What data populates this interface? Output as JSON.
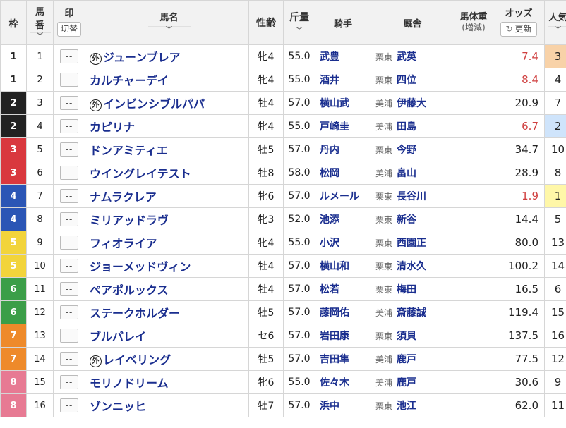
{
  "header": {
    "waku": "枠",
    "umaban_top": "馬",
    "umaban_bottom": "番",
    "mark": "印",
    "mark_toggle": "切替",
    "name": "馬名",
    "sexage": "性齢",
    "weight": "斤量",
    "jockey": "騎手",
    "stable": "厩舎",
    "body_weight": "馬体重",
    "body_weight_sub": "(増減)",
    "odds": "オッズ",
    "odds_refresh": "更新",
    "popularity": "人気",
    "sort_chevron": "﹀"
  },
  "mark_placeholder": "--",
  "foreign_badge": "外",
  "colors": {
    "waku1": "#ffffff",
    "waku2": "#222222",
    "waku3": "#d9383e",
    "waku4": "#2a55b5",
    "waku5": "#f2d43b",
    "waku6": "#3b9e48",
    "waku7": "#ee8a2a",
    "waku8": "#e77a93",
    "link": "#1a2e8f",
    "odds_favored": "#d04040",
    "pop1": "#fff7a8",
    "pop2": "#cfe4fb",
    "pop3": "#f8d2a8"
  },
  "rows": [
    {
      "waku": "1",
      "umaban": "1",
      "foreign": true,
      "name": "ジューンブレア",
      "sexage": "牝4",
      "weight": "55.0",
      "jockey": "武豊",
      "area": "栗東",
      "stable": "武英",
      "odds": "7.4",
      "pop": "3"
    },
    {
      "waku": "1",
      "umaban": "2",
      "foreign": false,
      "name": "カルチャーデイ",
      "sexage": "牝4",
      "weight": "55.0",
      "jockey": "酒井",
      "area": "栗東",
      "stable": "四位",
      "odds": "8.4",
      "pop": "4"
    },
    {
      "waku": "2",
      "umaban": "3",
      "foreign": true,
      "name": "インビンシブルパパ",
      "sexage": "牡4",
      "weight": "57.0",
      "jockey": "横山武",
      "area": "美浦",
      "stable": "伊藤大",
      "odds": "20.9",
      "pop": "7"
    },
    {
      "waku": "2",
      "umaban": "4",
      "foreign": false,
      "name": "カピリナ",
      "sexage": "牝4",
      "weight": "55.0",
      "jockey": "戸崎圭",
      "area": "美浦",
      "stable": "田島",
      "odds": "6.7",
      "pop": "2"
    },
    {
      "waku": "3",
      "umaban": "5",
      "foreign": false,
      "name": "ドンアミティエ",
      "sexage": "牡5",
      "weight": "57.0",
      "jockey": "丹内",
      "area": "栗東",
      "stable": "今野",
      "odds": "34.7",
      "pop": "10"
    },
    {
      "waku": "3",
      "umaban": "6",
      "foreign": false,
      "name": "ウイングレイテスト",
      "sexage": "牡8",
      "weight": "58.0",
      "jockey": "松岡",
      "area": "美浦",
      "stable": "畠山",
      "odds": "28.9",
      "pop": "8"
    },
    {
      "waku": "4",
      "umaban": "7",
      "foreign": false,
      "name": "ナムラクレア",
      "sexage": "牝6",
      "weight": "57.0",
      "jockey": "ルメール",
      "area": "栗東",
      "stable": "長谷川",
      "odds": "1.9",
      "pop": "1"
    },
    {
      "waku": "4",
      "umaban": "8",
      "foreign": false,
      "name": "ミリアッドラヴ",
      "sexage": "牝3",
      "weight": "52.0",
      "jockey": "池添",
      "area": "栗東",
      "stable": "新谷",
      "odds": "14.4",
      "pop": "5"
    },
    {
      "waku": "5",
      "umaban": "9",
      "foreign": false,
      "name": "フィオライア",
      "sexage": "牝4",
      "weight": "55.0",
      "jockey": "小沢",
      "area": "栗東",
      "stable": "西園正",
      "odds": "80.0",
      "pop": "13"
    },
    {
      "waku": "5",
      "umaban": "10",
      "foreign": false,
      "name": "ジョーメッドヴィン",
      "sexage": "牡4",
      "weight": "57.0",
      "jockey": "横山和",
      "area": "栗東",
      "stable": "清水久",
      "odds": "100.2",
      "pop": "14"
    },
    {
      "waku": "6",
      "umaban": "11",
      "foreign": false,
      "name": "ペアポルックス",
      "sexage": "牡4",
      "weight": "57.0",
      "jockey": "松若",
      "area": "栗東",
      "stable": "梅田",
      "odds": "16.5",
      "pop": "6"
    },
    {
      "waku": "6",
      "umaban": "12",
      "foreign": false,
      "name": "ステークホルダー",
      "sexage": "牡5",
      "weight": "57.0",
      "jockey": "藤岡佑",
      "area": "美浦",
      "stable": "斎藤誠",
      "odds": "119.4",
      "pop": "15"
    },
    {
      "waku": "7",
      "umaban": "13",
      "foreign": false,
      "name": "ブルバレイ",
      "sexage": "セ6",
      "weight": "57.0",
      "jockey": "岩田康",
      "area": "栗東",
      "stable": "須貝",
      "odds": "137.5",
      "pop": "16"
    },
    {
      "waku": "7",
      "umaban": "14",
      "foreign": true,
      "name": "レイベリング",
      "sexage": "牡5",
      "weight": "57.0",
      "jockey": "吉田隼",
      "area": "美浦",
      "stable": "鹿戸",
      "odds": "77.5",
      "pop": "12"
    },
    {
      "waku": "8",
      "umaban": "15",
      "foreign": false,
      "name": "モリノドリーム",
      "sexage": "牝6",
      "weight": "55.0",
      "jockey": "佐々木",
      "area": "美浦",
      "stable": "鹿戸",
      "odds": "30.6",
      "pop": "9"
    },
    {
      "waku": "8",
      "umaban": "16",
      "foreign": false,
      "name": "ゾンニッヒ",
      "sexage": "牡7",
      "weight": "57.0",
      "jockey": "浜中",
      "area": "栗東",
      "stable": "池江",
      "odds": "62.0",
      "pop": "11"
    }
  ]
}
